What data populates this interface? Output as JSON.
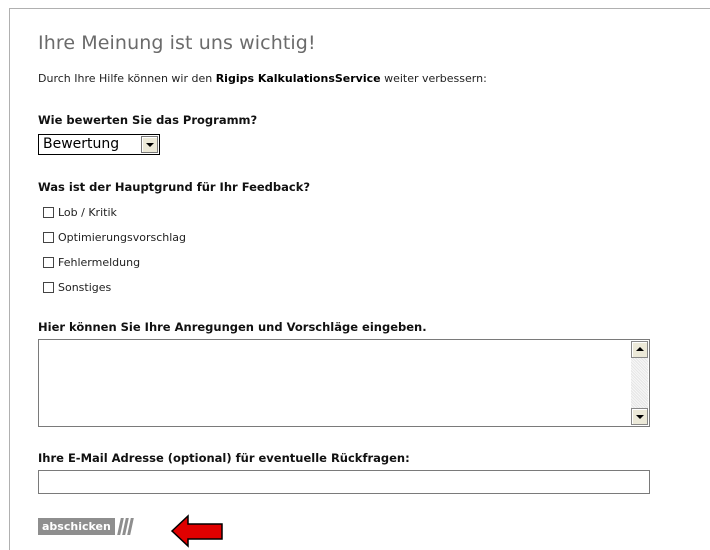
{
  "form": {
    "title": "Ihre Meinung ist uns wichtig!",
    "intro_prefix": "Durch Ihre Hilfe können wir den ",
    "intro_bold": "Rigips KalkulationsService",
    "intro_suffix": " weiter verbessern:",
    "rating": {
      "label": "Wie bewerten Sie das Programm?",
      "selected": "Bewertung"
    },
    "reason": {
      "label": "Was ist der Hauptgrund für Ihr Feedback?",
      "options": [
        "Lob / Kritik",
        "Optimierungsvorschlag",
        "Fehlermeldung",
        "Sonstiges"
      ]
    },
    "comments": {
      "label": "Hier können Sie Ihre Anregungen und Vorschläge eingeben.",
      "value": ""
    },
    "email": {
      "label": "Ihre E-Mail Adresse (optional) für eventuelle Rückfragen:",
      "value": ""
    },
    "submit_label": "abschicken"
  },
  "colors": {
    "title": "#6b6b6b",
    "button": "#8e8e8e",
    "pointer_arrow": "#e00000"
  },
  "icons": {
    "pointer": "red-arrow-left-icon"
  }
}
